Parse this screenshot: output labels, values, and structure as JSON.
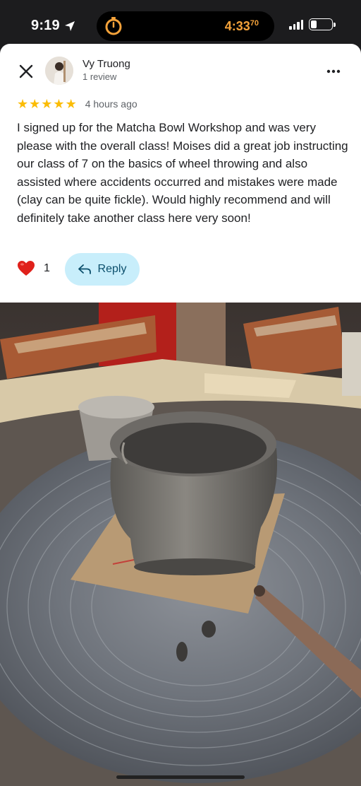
{
  "status_bar": {
    "time": "9:19",
    "timer": "4:33",
    "timer_sup": "70"
  },
  "review": {
    "author_name": "Vy Truong",
    "author_meta": "1 review",
    "rating": 5,
    "star_color": "#fbbc04",
    "time_ago": "4 hours ago",
    "text": "I signed up for the Matcha Bowl Workshop and was very please with the overall class! Moises did a great job instructing our class of 7 on the basics of wheel throwing and also assisted where accidents occurred and mistakes were made (clay can be quite fickle). Would highly recommend and will definitely take another class here very soon!",
    "like_count": "1",
    "reply_label": "Reply"
  },
  "icons": {
    "close": "close-icon",
    "more": "more-vert-icon",
    "heart": "heart-icon",
    "reply": "reply-arrow-icon"
  },
  "colors": {
    "reply_bg": "#c8eefb",
    "timer": "#f4a23a"
  }
}
